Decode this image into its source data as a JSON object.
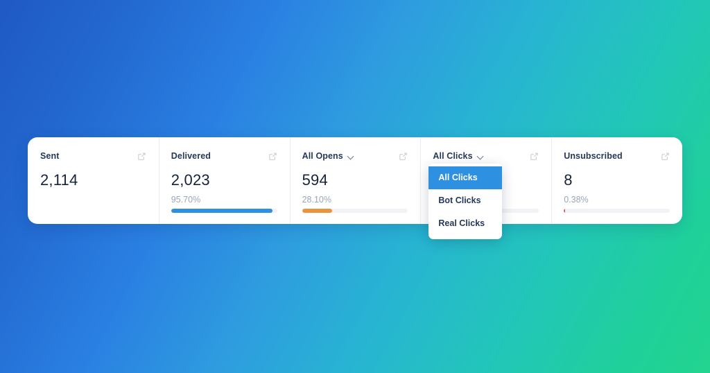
{
  "background": {
    "gradient_from": "#2059c4",
    "gradient_mid": "#2e9ddf",
    "gradient_to": "#22d48f"
  },
  "panel": {
    "cards": [
      {
        "title": "Sent",
        "value": "2,114",
        "percent": "",
        "bar_percent": 0,
        "bar_color": "#2e90e0",
        "has_dropdown": false,
        "has_bar": false,
        "icon": "external-link-icon"
      },
      {
        "title": "Delivered",
        "value": "2,023",
        "percent": "95.70%",
        "bar_percent": 95.7,
        "bar_color": "#2e90e0",
        "has_dropdown": false,
        "has_bar": true,
        "icon": "external-link-icon"
      },
      {
        "title": "All Opens",
        "value": "594",
        "percent": "28.10%",
        "bar_percent": 28.1,
        "bar_color": "#eb9440",
        "has_dropdown": true,
        "has_bar": true,
        "icon": "external-link-icon"
      },
      {
        "title": "All Clicks",
        "value": "",
        "percent": "",
        "bar_percent": 0,
        "bar_color": "#2e90e0",
        "has_dropdown": true,
        "has_bar": true,
        "icon": "external-link-icon"
      },
      {
        "title": "Unsubscribed",
        "value": "8",
        "percent": "0.38%",
        "bar_percent": 0.38,
        "bar_color": "#e05a5a",
        "has_dropdown": false,
        "has_bar": true,
        "icon": "external-link-icon"
      }
    ]
  },
  "dropdown": {
    "open_on_card": "All Clicks",
    "selected": "All Clicks",
    "highlight_color": "#2e90e0",
    "items": [
      {
        "label": "All Clicks"
      },
      {
        "label": "Bot Clicks"
      },
      {
        "label": "Real Clicks"
      }
    ]
  }
}
